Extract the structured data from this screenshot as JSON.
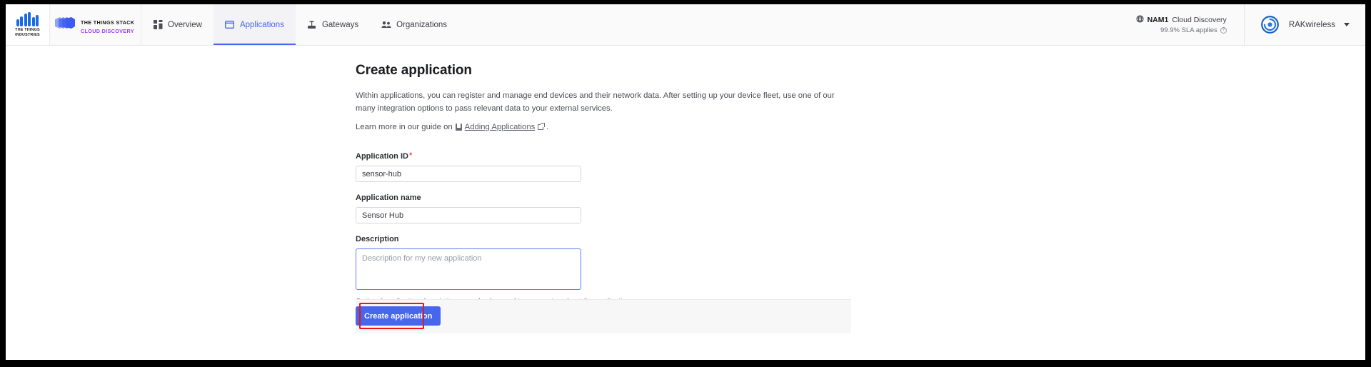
{
  "topbar": {
    "industries_logo": {
      "icon": "things-industries-bars-logo",
      "line1": "THE THINGS",
      "line2": "INDUSTRIES"
    },
    "stack_logo": {
      "icon": "things-stack-layers-logo",
      "line1": "THE THINGS STACK",
      "line2": "CLOUD DISCOVERY",
      "line2_color": "#9a3ff0"
    },
    "nav": [
      {
        "label": "Overview",
        "icon": "grid-icon",
        "active": false
      },
      {
        "label": "Applications",
        "icon": "application-window-icon",
        "active": true
      },
      {
        "label": "Gateways",
        "icon": "gateway-antenna-icon",
        "active": false
      },
      {
        "label": "Organizations",
        "icon": "organizations-people-icon",
        "active": false
      }
    ],
    "active_accent": "#4666ee",
    "cluster": {
      "icon": "globe-icon",
      "code": "NAM1",
      "name": "Cloud Discovery",
      "sla": "99.9% SLA applies",
      "help_icon": "question-circle-icon"
    },
    "user": {
      "avatar_icon": "rakwireless-logo",
      "name": "RAKwireless",
      "caret_icon": "chevron-down-icon"
    }
  },
  "main": {
    "title": "Create application",
    "intro": "Within applications, you can register and manage end devices and their network data. After setting up your device fleet, use one of our many integration options to pass relevant data to your external services.",
    "learn_more": {
      "prefix": "Learn more in our guide on",
      "book_icon": "book-icon",
      "link_text": "Adding Applications",
      "external_icon": "external-link-icon",
      "suffix": "."
    },
    "fields": {
      "app_id": {
        "label": "Application ID",
        "required_marker": "*",
        "value": "sensor-hub",
        "placeholder": ""
      },
      "app_name": {
        "label": "Application name",
        "value": "Sensor Hub",
        "placeholder": ""
      },
      "description": {
        "label": "Description",
        "value": "",
        "placeholder": "Description for my new application",
        "hint": "Optional application description; can also be used to save notes about the application",
        "focused": true,
        "focus_color": "#5b7cf5"
      }
    },
    "footer": {
      "submit_label": "Create application",
      "submit_color": "#4666ee"
    },
    "annotation": {
      "type": "highlight-rectangle",
      "color": "#f01414",
      "target": "create-application-button"
    }
  }
}
